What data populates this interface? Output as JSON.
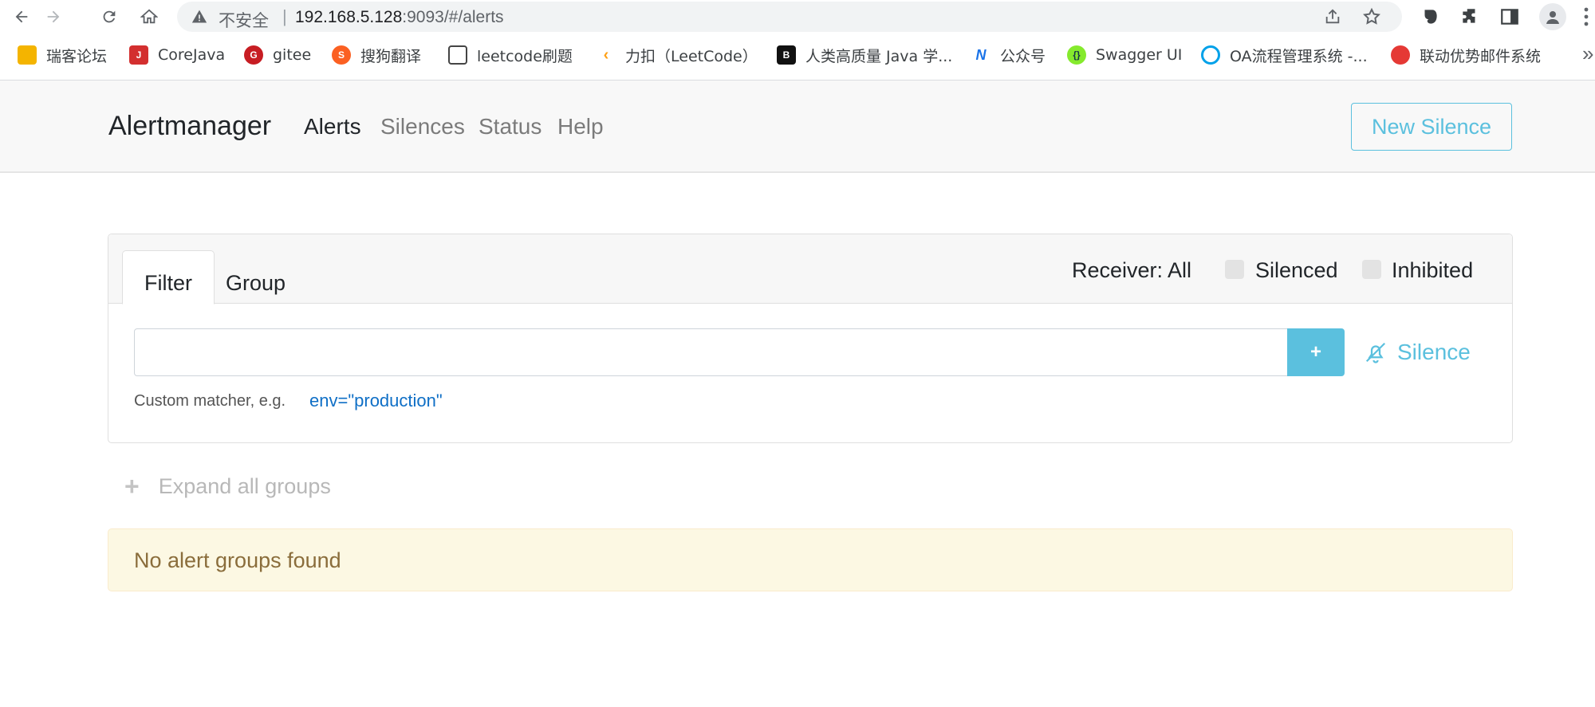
{
  "browser": {
    "insecure_label": "不安全",
    "url_host": "192.168.5.128",
    "url_rest": ":9093/#/alerts"
  },
  "bookmarks": [
    {
      "label": "瑞客论坛",
      "color": "#f4b400",
      "icon": "folder-note-icon"
    },
    {
      "label": "CoreJava",
      "color": "#d32f2f",
      "icon": "java-icon"
    },
    {
      "label": "gitee",
      "color": "#c71d23",
      "icon": "gitee-icon"
    },
    {
      "label": "搜狗翻译",
      "color": "#fb6022",
      "icon": "sogou-icon"
    },
    {
      "label": "leetcode刷题",
      "color": "#444444",
      "icon": "book-icon"
    },
    {
      "label": "力扣（LeetCode）",
      "color": "#ffa116",
      "icon": "leetcode-icon"
    },
    {
      "label": "人类高质量 Java 学...",
      "color": "#111111",
      "icon": "bilibili-tv-icon"
    },
    {
      "label": "公众号",
      "color": "#1a73e8",
      "icon": "wechat-mp-icon"
    },
    {
      "label": "Swagger UI",
      "color": "#85ea2d",
      "icon": "swagger-icon"
    },
    {
      "label": "OA流程管理系统 -...",
      "color": "#00a1e9",
      "icon": "oa-icon"
    },
    {
      "label": "联动优势邮件系统",
      "color": "#e53935",
      "icon": "mail-icon"
    }
  ],
  "bookmarks_more": "»",
  "navbar": {
    "brand": "Alertmanager",
    "links": [
      "Alerts",
      "Silences",
      "Status",
      "Help"
    ],
    "new_silence": "New Silence"
  },
  "filter_card": {
    "tabs": [
      "Filter",
      "Group"
    ],
    "receiver": "Receiver: All",
    "silenced_label": "Silenced",
    "inhibited_label": "Inhibited",
    "input_value": "",
    "add_button": "+",
    "silence_link": "Silence",
    "hint_text": "Custom matcher, e.g.",
    "hint_example": "env=\"production\""
  },
  "expand_all": "Expand all groups",
  "empty_message": "No alert groups found",
  "colors": {
    "accent": "#5bc0de",
    "warning_bg": "#fcf8e3",
    "warning_text": "#8a6d3b",
    "navbar_bg": "#f8f8f8"
  }
}
